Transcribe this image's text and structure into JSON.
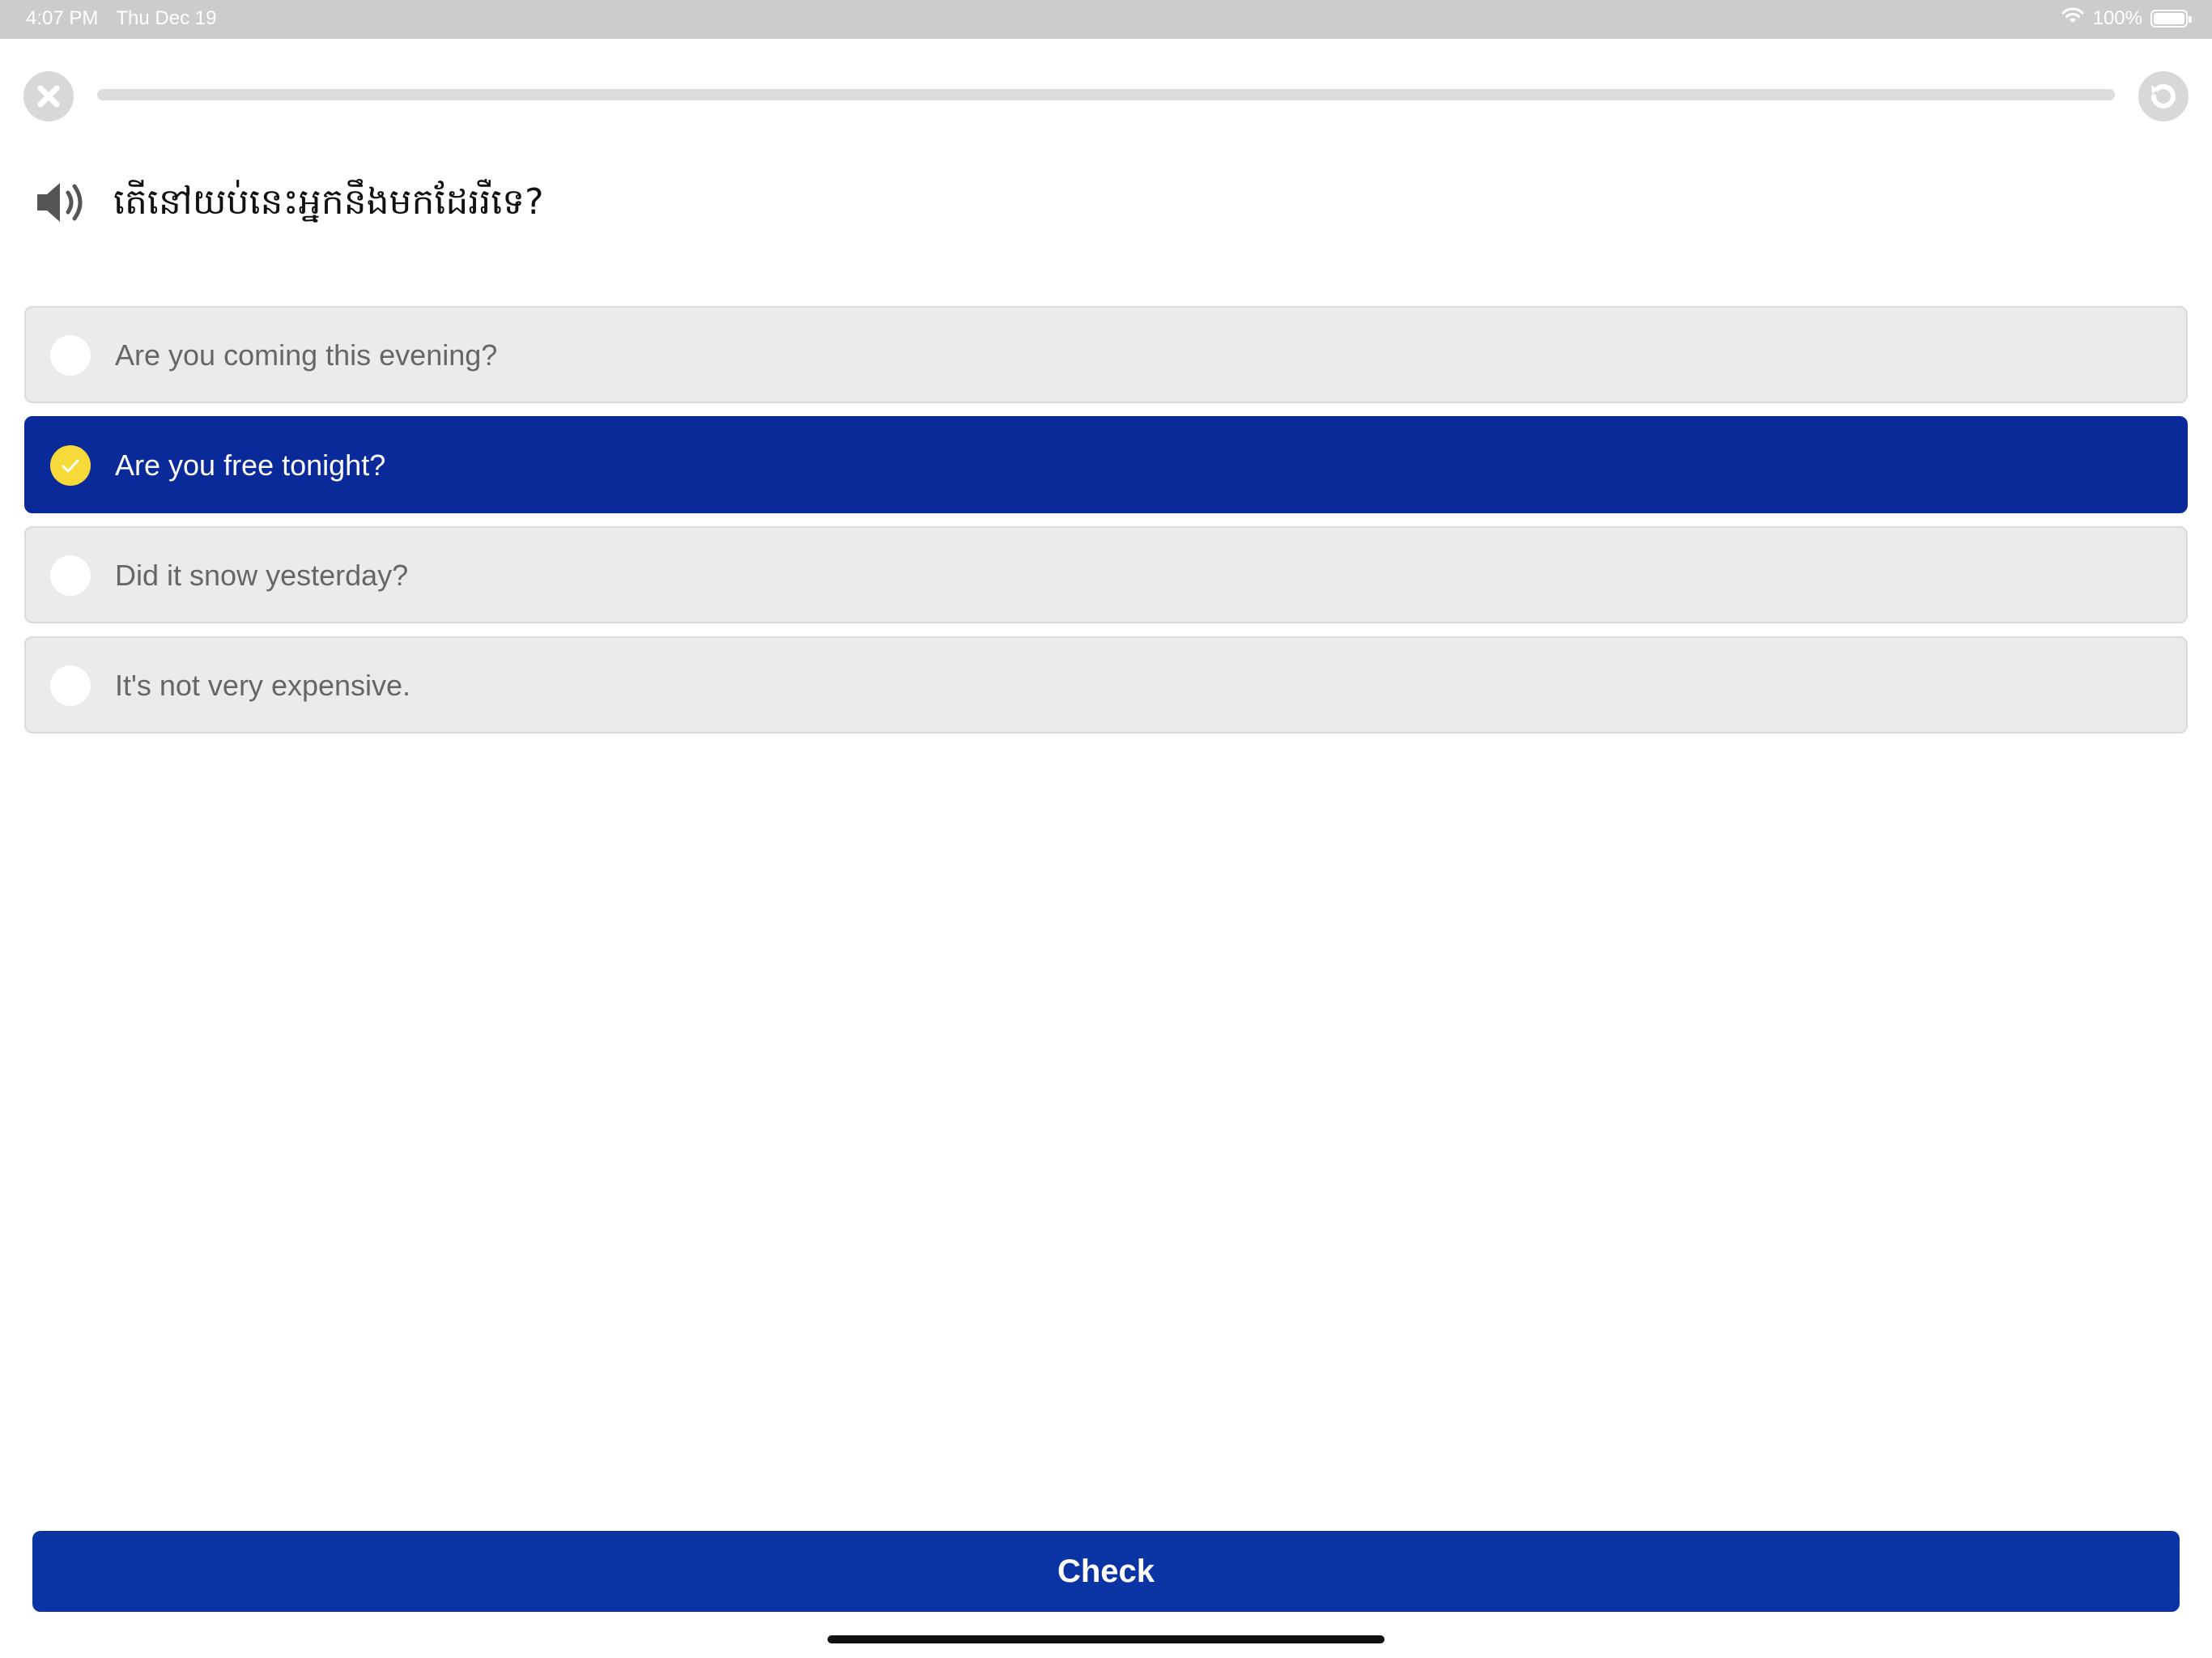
{
  "status_bar": {
    "time": "4:07 PM",
    "date": "Thu Dec 19",
    "battery_text": "100%",
    "battery_level": 1.0
  },
  "top_bar": {
    "close_icon": "x-circle-icon",
    "reset_icon": "refresh-icon",
    "progress": 0.0
  },
  "prompt": {
    "speaker_icon": "speaker-icon",
    "text": "តើនៅយប់នេះអ្នកនឹងមកដែររឺទេ?"
  },
  "options": [
    {
      "label": "Are you coming this evening?",
      "selected": false
    },
    {
      "label": "Are you free tonight?",
      "selected": true
    },
    {
      "label": "Did it snow yesterday?",
      "selected": false
    },
    {
      "label": "It's not very expensive.",
      "selected": false
    }
  ],
  "check_button": {
    "label": "Check"
  },
  "colors": {
    "primary": "#0a2a99",
    "check_button": "#0a34a3",
    "selected_radio": "#f6da3a",
    "option_bg": "#ebebeb"
  }
}
